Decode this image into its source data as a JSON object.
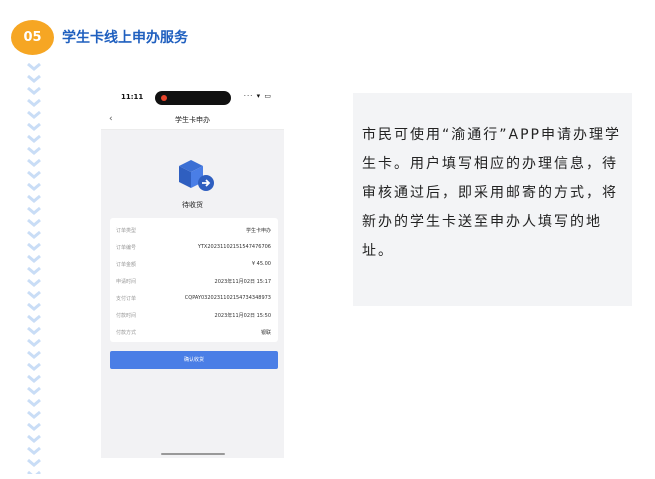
{
  "section": {
    "number": "05",
    "title": "学生卡线上申办服务",
    "accent_color": "#f6a623",
    "title_color": "#1f5fbf"
  },
  "phone": {
    "status_time": "11:11",
    "status_icons": "··· ▾ ▭",
    "nav_back_icon": "chevron-left-icon",
    "nav_title": "学生卡申办",
    "status_icon_name": "package-delivery-icon",
    "status_text": "待收货",
    "details": [
      {
        "label": "订单类型",
        "value": "学生卡申办"
      },
      {
        "label": "订单编号",
        "value": "YTX2023110215154747670​6"
      },
      {
        "label": "订单金额",
        "value": "¥ 45.00"
      },
      {
        "label": "申请时间",
        "value": "2023年11月02日 15:17"
      },
      {
        "label": "支付订单",
        "value": "CQPAY03202311021547343489​73"
      },
      {
        "label": "付款时间",
        "value": "2023年11月02日 15:50"
      },
      {
        "label": "付款方式",
        "value": "银联"
      }
    ],
    "confirm_button": "确认收货",
    "button_color": "#4a7ee6"
  },
  "description": "市民可使用“渝通行”APP申请办理学生卡。用户填写相应的办理信息，待审核通过后，即采用邮寄的方式，将新办的学生卡送至申办人填写的地址。"
}
